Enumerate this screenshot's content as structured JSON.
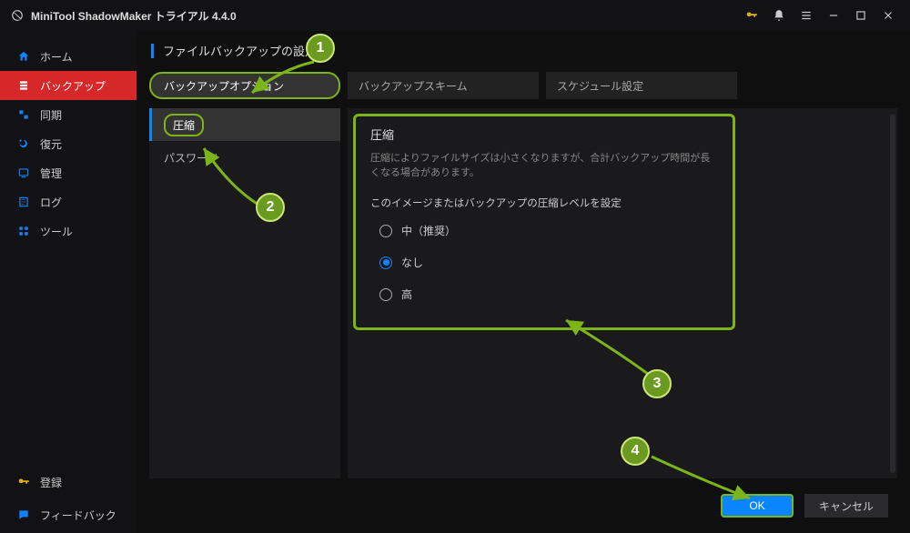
{
  "title": "MiniTool ShadowMaker トライアル 4.4.0",
  "sidebar": {
    "items": [
      {
        "label": "ホーム",
        "icon": "home"
      },
      {
        "label": "バックアップ",
        "icon": "backup",
        "active": true
      },
      {
        "label": "同期",
        "icon": "sync"
      },
      {
        "label": "復元",
        "icon": "restore"
      },
      {
        "label": "管理",
        "icon": "manage"
      },
      {
        "label": "ログ",
        "icon": "log"
      },
      {
        "label": "ツール",
        "icon": "tools"
      }
    ],
    "bottom": [
      {
        "label": "登録",
        "icon": "key"
      },
      {
        "label": "フィードバック",
        "icon": "feedback"
      }
    ]
  },
  "page": {
    "title": "ファイルバックアップの設定"
  },
  "tabs": [
    {
      "label": "バックアップオプション",
      "active": true
    },
    {
      "label": "バックアップスキーム"
    },
    {
      "label": "スケジュール設定"
    }
  ],
  "nav": [
    {
      "label": "圧縮",
      "active": true
    },
    {
      "label": "パスワード"
    }
  ],
  "panel": {
    "title": "圧縮",
    "desc": "圧縮によりファイルサイズは小さくなりますが、合計バックアップ時間が長くなる場合があります。",
    "sub": "このイメージまたはバックアップの圧縮レベルを設定",
    "options": [
      {
        "label": "中（推奨）",
        "selected": false
      },
      {
        "label": "なし",
        "selected": true
      },
      {
        "label": "高",
        "selected": false
      }
    ]
  },
  "footer": {
    "ok": "OK",
    "cancel": "キャンセル"
  },
  "badges": [
    "1",
    "2",
    "3",
    "4"
  ],
  "colors": {
    "accent": "#0a84ff",
    "annotation": "#7cb518"
  }
}
